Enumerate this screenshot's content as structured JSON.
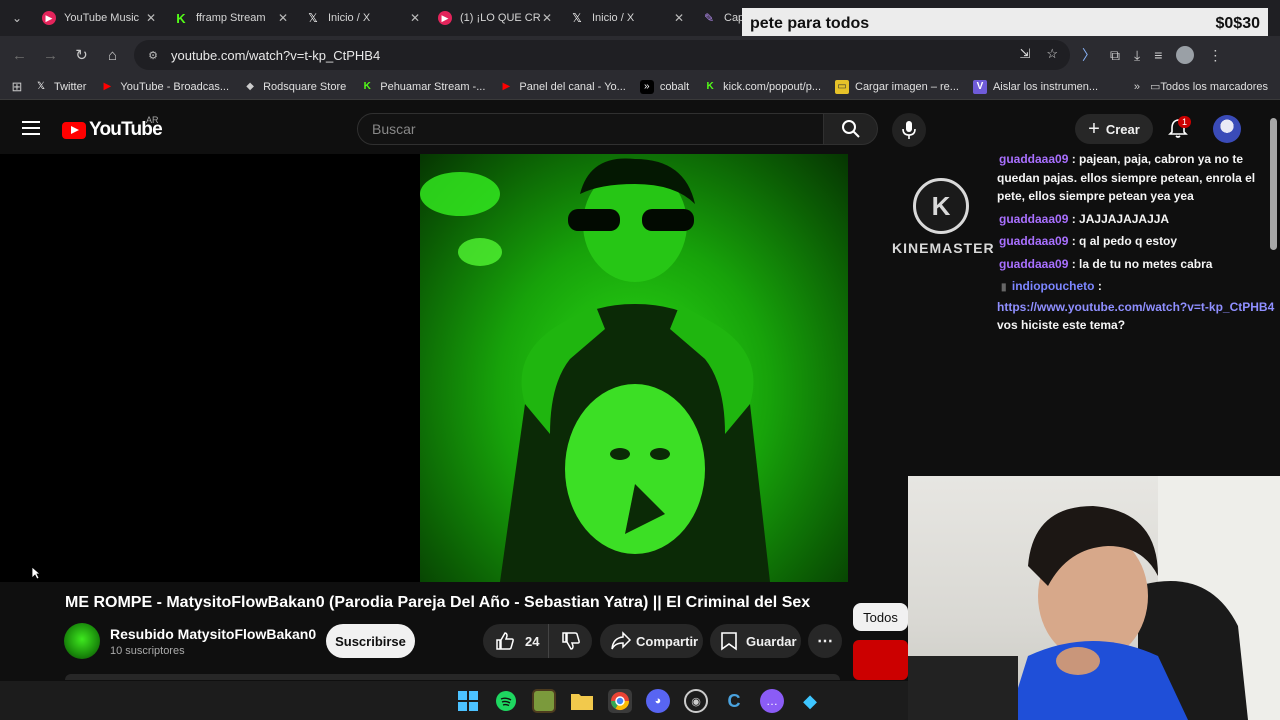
{
  "browser": {
    "tabs": [
      {
        "label": "YouTube Music",
        "icon": "youtube-music-icon"
      },
      {
        "label": "fframp Stream",
        "icon": "kick-icon"
      },
      {
        "label": "Inicio / X",
        "icon": "x-icon"
      },
      {
        "label": "(1) ¡LO QUE CR",
        "icon": "youtube-icon"
      },
      {
        "label": "Inicio / X",
        "icon": "x-icon"
      },
      {
        "label": "Capt",
        "icon": "pen-icon"
      }
    ],
    "url": "youtube.com/watch?v=t-kp_CtPHB4",
    "bookmarks": [
      {
        "label": "Twitter",
        "icon": "x-icon"
      },
      {
        "label": "YouTube - Broadcas...",
        "icon": "youtube-icon"
      },
      {
        "label": "Rodsquare Store",
        "icon": "store-icon"
      },
      {
        "label": "Pehuamar Stream -...",
        "icon": "kick-icon"
      },
      {
        "label": "Panel del canal - Yo...",
        "icon": "youtube-icon"
      },
      {
        "label": "cobalt",
        "icon": "cobalt-icon"
      },
      {
        "label": "kick.com/popout/p...",
        "icon": "kick-icon"
      },
      {
        "label": "Cargar imagen – re...",
        "icon": "image-icon"
      },
      {
        "label": "Aislar los instrumen...",
        "icon": "v-icon"
      }
    ],
    "all_bookmarks_label": "Todos los marcadores"
  },
  "donation_goal": {
    "title": "pete para todos",
    "current": "$0",
    "target": "$30"
  },
  "youtube": {
    "logo_text": "YouTube",
    "country": "AR",
    "search_placeholder": "Buscar",
    "create_label": "Crear",
    "notification_count": "1",
    "video": {
      "title": "ME ROMPE - MatysitoFlowBakan0 (Parodia Pareja Del Año - Sebastian Yatra) || El Criminal del Sex",
      "channel": "Resubido MatysitoFlowBakan0",
      "subscribers": "10 suscriptores",
      "subscribe_label": "Suscribirse",
      "likes": "24",
      "share_label": "Compartir",
      "save_label": "Guardar"
    },
    "chip_label": "Todos"
  },
  "watermark": {
    "letter": "K",
    "text": "KINEMASTER"
  },
  "chat": {
    "messages": [
      {
        "user": "guaddaaa09",
        "text": ": pajean, paja, cabron ya no te quedan pajas. ellos siempre petean, enrola el pete, ellos siempre petean yea yea"
      },
      {
        "user": "guaddaaa09",
        "text": ": JAJJAJAJAJJA"
      },
      {
        "user": "guaddaaa09",
        "text": ": q al pedo q estoy"
      },
      {
        "user": "guaddaaa09",
        "text": ": la de tu no metes cabra"
      },
      {
        "user": "indiopoucheto",
        "text": ":",
        "link": "https://www.youtube.com/watch?v=t-kp_CtPHB4",
        "after": "vos hiciste este tema?"
      }
    ]
  },
  "colors": {
    "kick_green": "#53fc18",
    "youtube_red": "#ff0000",
    "chat_user": "#a970ff",
    "player_green": "#2bdc16"
  }
}
